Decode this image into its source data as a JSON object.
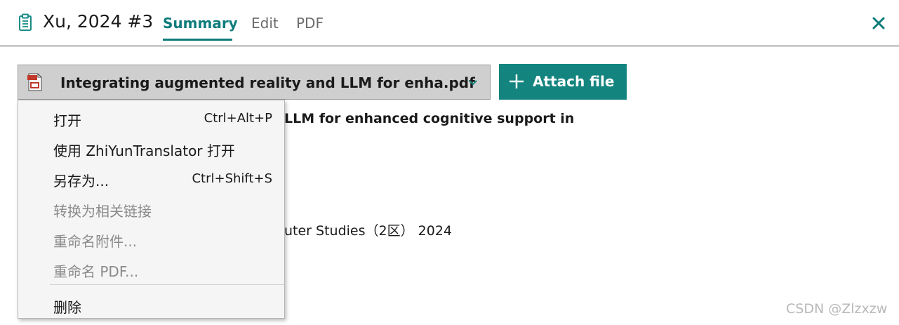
{
  "header": {
    "title": "Xu, 2024 #3",
    "icon": "clipboard-icon",
    "tabs": [
      {
        "label": "Summary",
        "active": true
      },
      {
        "label": "Edit",
        "active": false
      },
      {
        "label": "PDF",
        "active": false
      }
    ],
    "close_icon": "close-icon",
    "accent_color": "#0e7c7b"
  },
  "attachment": {
    "selected_file": "Integrating augmented reality and LLM for enha.pdf",
    "file_icon": "pdf-file-icon",
    "attach_button_label": "Attach file",
    "attach_button_color": "#14847f"
  },
  "background_content": {
    "title_fragment": "LLM for enhanced cognitive support in",
    "publication_fragment": "uter Studies（2区） 2024"
  },
  "context_menu": {
    "items": [
      {
        "label": "打开",
        "shortcut": "Ctrl+Alt+P",
        "enabled": true
      },
      {
        "label": "使用 ZhiYunTranslator 打开",
        "shortcut": "",
        "enabled": true
      },
      {
        "label": "另存为...",
        "shortcut": "Ctrl+Shift+S",
        "enabled": true
      },
      {
        "label": "转换为相关链接",
        "shortcut": "",
        "enabled": false
      },
      {
        "label": "重命名附件...",
        "shortcut": "",
        "enabled": false
      },
      {
        "label": "重命名 PDF...",
        "shortcut": "",
        "enabled": false
      },
      {
        "label": "删除",
        "shortcut": "",
        "enabled": true
      }
    ]
  },
  "watermark": "CSDN @Zlzxzw"
}
